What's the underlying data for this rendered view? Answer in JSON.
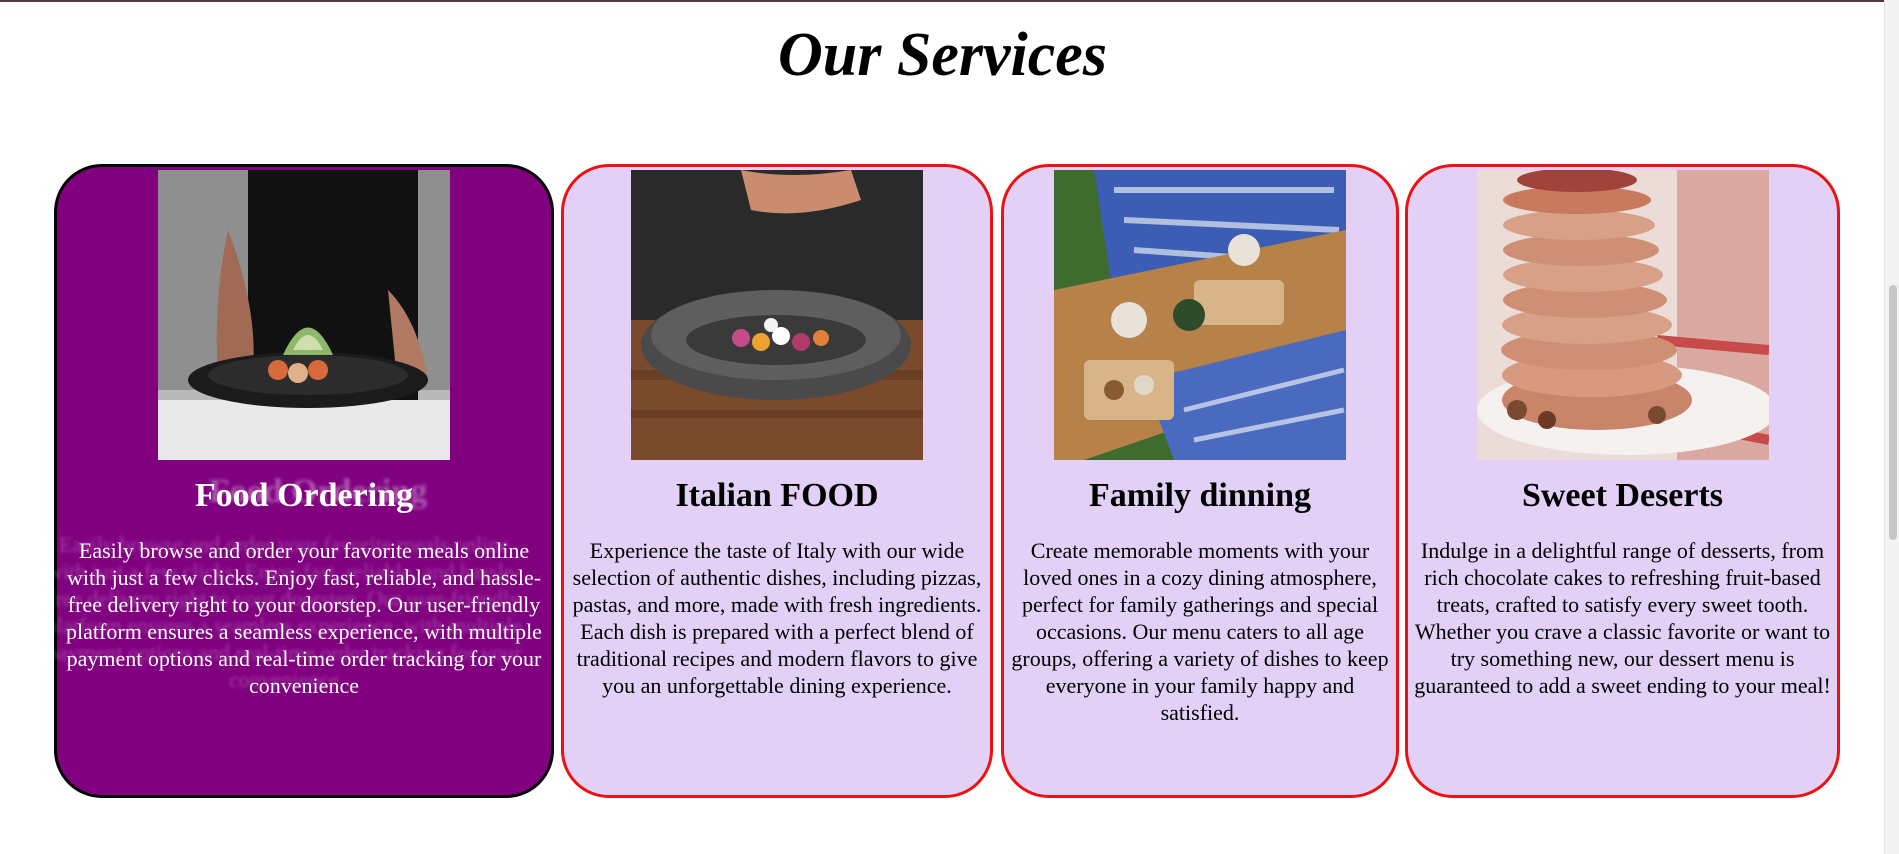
{
  "page": {
    "title": "Our Services"
  },
  "cards": [
    {
      "title": "Food Ordering",
      "text": "Easily browse and order your favorite meals online with just a few clicks. Enjoy fast, reliable, and hassle-free delivery right to your doorstep. Our user-friendly platform ensures a seamless experience, with multiple payment options and real-time order tracking for your convenience",
      "image": "chef-plating-dish-photo",
      "state": "hovered"
    },
    {
      "title": "Italian FOOD",
      "text": "Experience the taste of Italy with our wide selection of authentic dishes, including pizzas, pastas, and more, made with fresh ingredients. Each dish is prepared with a perfect blend of traditional recipes and modern flavors to give you an unforgettable dining experience.",
      "image": "seasoning-bowl-photo"
    },
    {
      "title": "Family dinning",
      "text": "Create memorable moments with your loved ones in a cozy dining atmosphere, perfect for family gatherings and special occasions. Our menu caters to all age groups, offering a variety of dishes to keep everyone in your family happy and satisfied.",
      "image": "picnic-spread-photo"
    },
    {
      "title": "Sweet Deserts",
      "text": "Indulge in a delightful range of desserts, from rich chocolate cakes to refreshing fruit-based treats, crafted to satisfy every sweet tooth. Whether you crave a classic favorite or want to try something new, our dessert menu is guaranteed to add a sweet ending to your meal!",
      "image": "pancake-stack-photo"
    }
  ],
  "colors": {
    "active_card_bg": "#800080",
    "card_bg": "#e2d0f7",
    "card_border": "#ee1111",
    "active_card_border": "#000000"
  }
}
